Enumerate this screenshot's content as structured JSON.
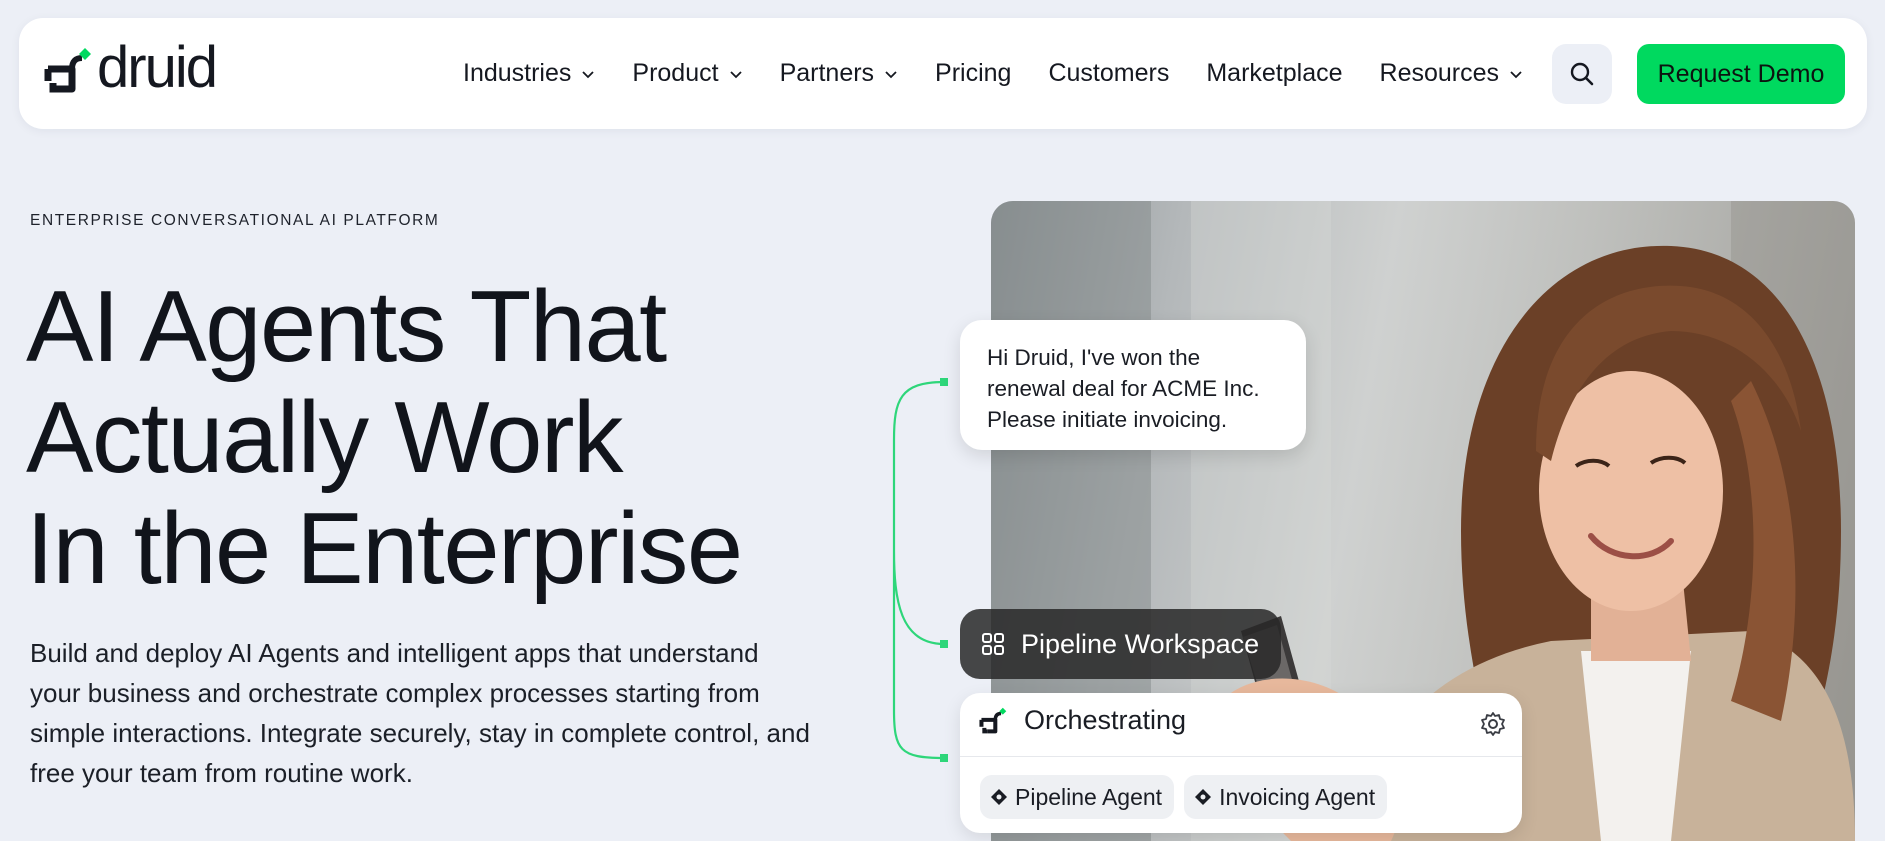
{
  "brand": {
    "name": "druid",
    "accent": "#00d95f"
  },
  "nav": {
    "items": [
      {
        "label": "Industries",
        "dropdown": true
      },
      {
        "label": "Product",
        "dropdown": true
      },
      {
        "label": "Partners",
        "dropdown": true
      },
      {
        "label": "Pricing",
        "dropdown": false
      },
      {
        "label": "Customers",
        "dropdown": false
      },
      {
        "label": "Marketplace",
        "dropdown": false
      },
      {
        "label": "Resources",
        "dropdown": true
      }
    ],
    "search_icon": "search-icon",
    "cta_label": "Request Demo"
  },
  "hero": {
    "eyebrow": "ENTERPRISE CONVERSATIONAL AI PLATFORM",
    "title_lines": [
      "AI Agents That",
      "Actually Work",
      "In the Enterprise"
    ],
    "description": "Build and deploy AI Agents and intelligent apps that understand your business and orchestrate complex processes starting from simple interactions. Integrate securely, stay in complete control, and free your team from routine work."
  },
  "illustration": {
    "chat_lines": [
      "Hi Druid, I've won the",
      "renewal deal for ACME Inc.",
      "Please initiate invoicing."
    ],
    "workspace_label": "Pipeline Workspace",
    "orchestration_label": "Orchestrating",
    "agents": [
      "Pipeline Agent",
      "Invoicing Agent"
    ]
  }
}
